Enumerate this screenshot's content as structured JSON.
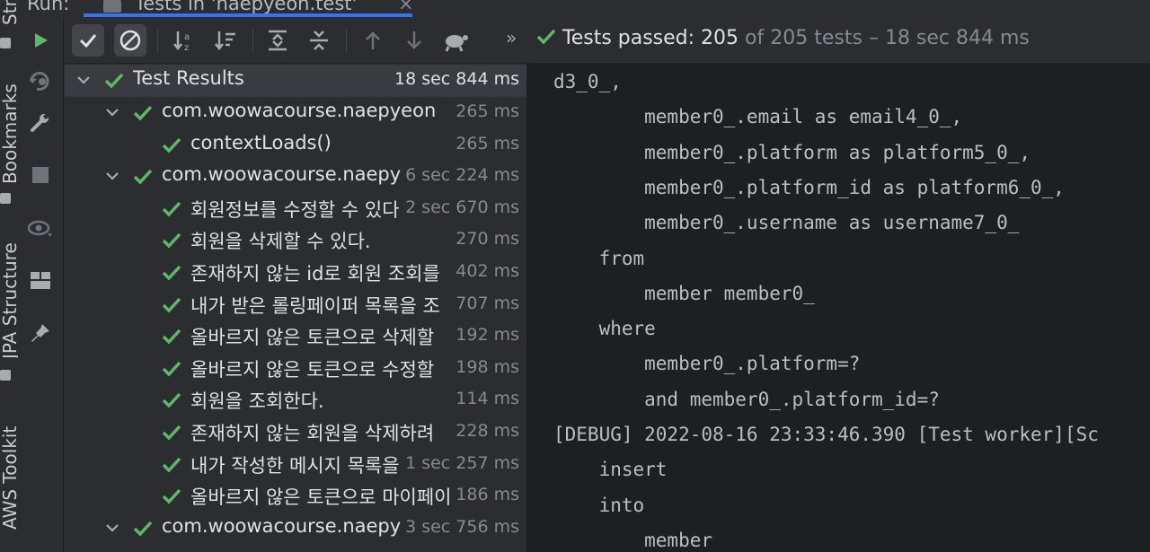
{
  "tabs": {
    "run_label": "Run:",
    "active_tab": "Tests in 'naepyeon.test'"
  },
  "side_strip": {
    "structure": "Structure",
    "bookmarks": "Bookmarks",
    "jpa": "JPA Structure",
    "aws": "AWS Toolkit"
  },
  "status": {
    "passed_label": "Tests passed: 205",
    "of_label": "of 205 tests",
    "time_label": "– 18 sec 844 ms",
    "colors": {
      "pass": "#5fb865",
      "muted": "#868a91"
    }
  },
  "tree": {
    "root": {
      "label": "Test Results",
      "duration": "18 sec 844 ms"
    },
    "rows": [
      {
        "label": "com.woowacourse.naepyeon",
        "duration": "265 ms",
        "level": 1,
        "expandable": true
      },
      {
        "label": "contextLoads()",
        "duration": "265 ms",
        "level": 2,
        "expandable": false
      },
      {
        "label": "com.woowacourse.naepyeon",
        "duration": "6 sec 224 ms",
        "level": 1,
        "expandable": true
      },
      {
        "label": "회원정보를 수정할 수 있다",
        "duration": "2 sec 670 ms",
        "level": 2,
        "expandable": false
      },
      {
        "label": "회원을 삭제할 수 있다.",
        "duration": "270 ms",
        "level": 2,
        "expandable": false
      },
      {
        "label": "존재하지 않는 id로 회원 조회를",
        "duration": "402 ms",
        "level": 2,
        "expandable": false
      },
      {
        "label": "내가 받은 롤링페이퍼 목록을 조",
        "duration": "707 ms",
        "level": 2,
        "expandable": false
      },
      {
        "label": "올바르지 않은 토큰으로 삭제할",
        "duration": "192 ms",
        "level": 2,
        "expandable": false
      },
      {
        "label": "올바르지 않은 토큰으로 수정할",
        "duration": "198 ms",
        "level": 2,
        "expandable": false
      },
      {
        "label": "회원을 조회한다.",
        "duration": "114 ms",
        "level": 2,
        "expandable": false
      },
      {
        "label": "존재하지 않는 회원을 삭제하려",
        "duration": "228 ms",
        "level": 2,
        "expandable": false
      },
      {
        "label": "내가 작성한 메시지 목록을",
        "duration": "1 sec 257 ms",
        "level": 2,
        "expandable": false
      },
      {
        "label": "올바르지 않은 토큰으로 마이페이",
        "duration": "186 ms",
        "level": 2,
        "expandable": false
      },
      {
        "label": "com.woowacourse.naepyeon",
        "duration": "3 sec 756 ms",
        "level": 1,
        "expandable": true
      }
    ]
  },
  "console": {
    "lines": [
      "d3_0_,",
      "        member0_.email as email4_0_,",
      "        member0_.platform as platform5_0_,",
      "        member0_.platform_id as platform6_0_,",
      "        member0_.username as username7_0_",
      "    from",
      "        member member0_",
      "    where",
      "        member0_.platform=?",
      "        and member0_.platform_id=?",
      "[DEBUG] 2022-08-16 23:33:46.390 [Test worker][Sc",
      "    insert",
      "    into",
      "        member"
    ]
  },
  "icons": {
    "run": "play-icon",
    "rerun_failed": "rerun-failed-icon",
    "settings": "wrench-icon",
    "stop": "stop-icon",
    "show_passed": "check-icon",
    "show_ignored": "ignored-icon",
    "sort_alpha": "sort-alpha-icon",
    "sort_duration": "sort-duration-icon",
    "expand_all": "expand-all-icon",
    "collapse_all": "collapse-all-icon",
    "prev": "arrow-up-icon",
    "next": "arrow-down-icon",
    "export": "turtle-icon",
    "more": "double-chevron-icon"
  }
}
